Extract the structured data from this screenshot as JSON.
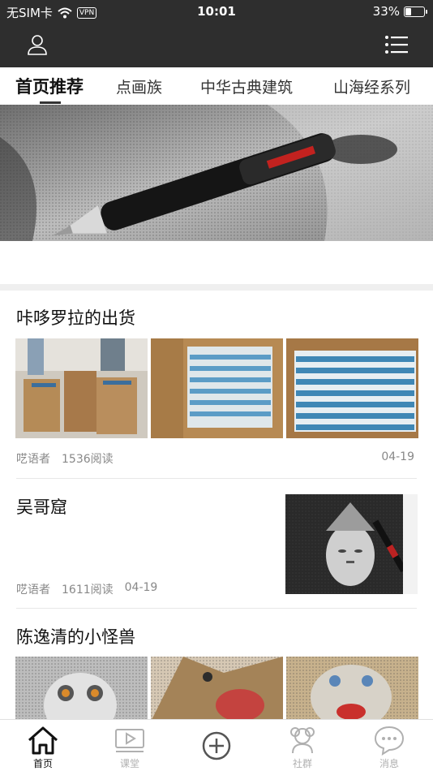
{
  "status_bar": {
    "carrier": "无SIM卡",
    "vpn": "VPN",
    "time": "10:01",
    "battery_percent": "33%",
    "battery_level": 0.33
  },
  "nav": {
    "user_icon": "user-icon",
    "menu_icon": "list-menu-icon"
  },
  "tabs": [
    {
      "label": "首页推荐"
    },
    {
      "label": "点画族"
    },
    {
      "label": "中华古典建筑"
    },
    {
      "label": "山海经系列"
    }
  ],
  "articles": [
    {
      "title": "咔哆罗拉的出货",
      "author": "呓语者",
      "reads": "1536阅读",
      "date": "04-19"
    },
    {
      "title": "吴哥窟",
      "author": "呓语者",
      "reads": "1611阅读",
      "date": "04-19"
    },
    {
      "title": "陈逸清的小怪兽"
    }
  ],
  "tabbar": [
    {
      "label": "首页",
      "icon": "home-icon"
    },
    {
      "label": "课堂",
      "icon": "video-icon"
    },
    {
      "label": "",
      "icon": "add-circle-icon"
    },
    {
      "label": "社群",
      "icon": "community-icon"
    },
    {
      "label": "消息",
      "icon": "message-icon"
    }
  ],
  "colors": {
    "header_bg": "#2e2e2e",
    "inactive_tab": "#b0b0b0",
    "active_tab": "#111111"
  }
}
